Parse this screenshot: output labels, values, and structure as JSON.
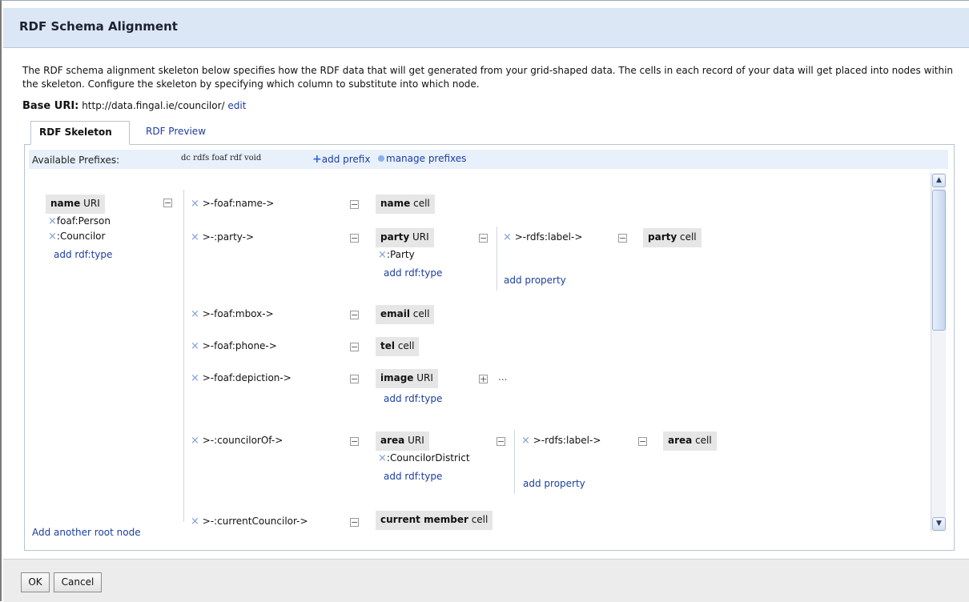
{
  "dialog": {
    "title": "RDF Schema Alignment",
    "description": "The RDF schema alignment skeleton below specifies how the RDF data that will get generated from your grid-shaped data. The cells in each record of your data will get placed into nodes within the skeleton. Configure the skeleton by specifying which column to substitute into which node.",
    "base_uri_label": "Base URI:",
    "base_uri_value": "http://data.fingal.ie/councilor/",
    "base_uri_edit": "edit"
  },
  "tabs": [
    {
      "label": "RDF Skeleton",
      "active": true
    },
    {
      "label": "RDF Preview",
      "active": false
    }
  ],
  "prefixes": {
    "label": "Available Prefixes:",
    "list": "dc rdfs foaf rdf void",
    "add_prefix": "add prefix",
    "manage_prefixes": "manage prefixes"
  },
  "root": {
    "name_bold": "name",
    "name_rest": " URI",
    "types": [
      "foaf:Person",
      ":Councilor"
    ],
    "add_type": "add rdf:type"
  },
  "properties": [
    {
      "label": ">-foaf:name->",
      "node_bold": "name",
      "node_rest": " cell"
    },
    {
      "label": ">-:party->",
      "node_bold": "party",
      "node_rest": " URI",
      "types": [
        ":Party"
      ],
      "add_type": "add rdf:type",
      "sub_property": ">-rdfs:label->",
      "sub_node_bold": "party",
      "sub_node_rest": " cell",
      "add_property": "add property"
    },
    {
      "label": ">-foaf:mbox->",
      "node_bold": "email",
      "node_rest": " cell"
    },
    {
      "label": ">-foaf:phone->",
      "node_bold": "tel",
      "node_rest": " cell"
    },
    {
      "label": ">-foaf:depiction->",
      "node_bold": "image",
      "node_rest": " URI",
      "add_type": "add rdf:type",
      "collapsed": "..."
    },
    {
      "label": ">-:councilorOf->",
      "node_bold": "area",
      "node_rest": " URI",
      "types": [
        ":CouncilorDistrict"
      ],
      "add_type": "add rdf:type",
      "sub_property": ">-rdfs:label->",
      "sub_node_bold": "area",
      "sub_node_rest": " cell",
      "add_property": "add property"
    },
    {
      "label": ">-:currentCouncilor->",
      "node_bold": "current member",
      "node_rest": " cell"
    }
  ],
  "add_root": "Add another root node",
  "footer": {
    "ok": "OK",
    "cancel": "Cancel"
  }
}
